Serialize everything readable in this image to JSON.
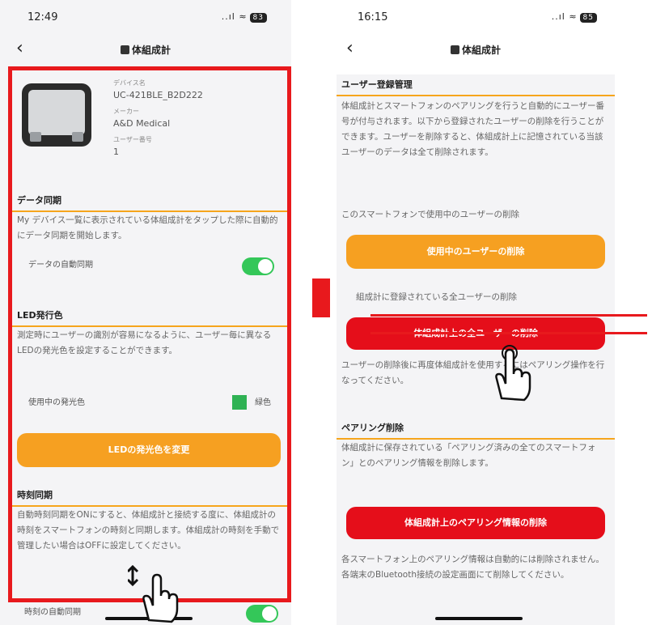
{
  "left": {
    "time": "12:49",
    "signal": "..ıl ≈",
    "battery": "83",
    "nav_title": "体組成計",
    "device": {
      "name_label": "デバイス名",
      "name": "UC-421BLE_B2D222",
      "maker_label": "メーカー",
      "maker": "A&D Medical",
      "user_label": "ユーザー番号",
      "user_no": "1"
    },
    "sync_head": "データ同期",
    "sync_body": "My デバイス一覧に表示されている体組成計をタップした際に自動的にデータ同期を開始します。",
    "auto_sync": "データの自動同期",
    "led_head": "LED発行色",
    "led_body": "測定時にユーザーの識別が容易になるように、ユーザー毎に異なるLEDの発光色を設定することができます。",
    "led_current_label": "使用中の発光色",
    "led_color_name": "緑色",
    "led_btn": "LEDの発光色を変更",
    "time_head": "時刻同期",
    "time_body": "自動時刻同期をONにすると、体組成計と接続する度に、体組成計の時刻をスマートフォンの時刻と同期します。体組成計の時刻を手動で管理したい場合はOFFに設定してください。",
    "auto_time": "時刻の自動同期"
  },
  "right": {
    "time": "16:15",
    "signal": "..ıl ≈",
    "battery": "85",
    "nav_title": "体組成計",
    "user_head": "ユーザー登録管理",
    "user_body": "体組成計とスマートフォンのペアリングを行うと自動的にユーザー番号が付与されます。以下から登録されたユーザーの削除を行うことができます。ユーザーを削除すると、体組成計上に記憶されている当該ユーザーのデータは全て削除されます。",
    "delete_current_label": "このスマートフォンで使用中のユーザーの削除",
    "delete_current_btn": "使用中のユーザーの削除",
    "delete_all_label": "組成計に登録されている全ユーザーの削除",
    "delete_all_btn": "体組成計上の全ユーザーの削除",
    "after_delete_note": "ユーザーの削除後に再度体組成計を使用するにはペアリング操作を行なってください。",
    "pair_head": "ペアリング削除",
    "pair_body": "体組成計に保存されている「ペアリング済みの全てのスマートフォン」とのペアリング情報を削除します。",
    "pair_btn": "体組成計上のペアリング情報の削除",
    "pair_note": "各スマートフォン上のペアリング情報は自動的には削除されません。各端末のBluetooth接続の設定画面にて削除してください。"
  },
  "colors": {
    "red": "#e8191d",
    "orange": "#f6a021",
    "green": "#34c759",
    "led_green": "#2fb254"
  }
}
